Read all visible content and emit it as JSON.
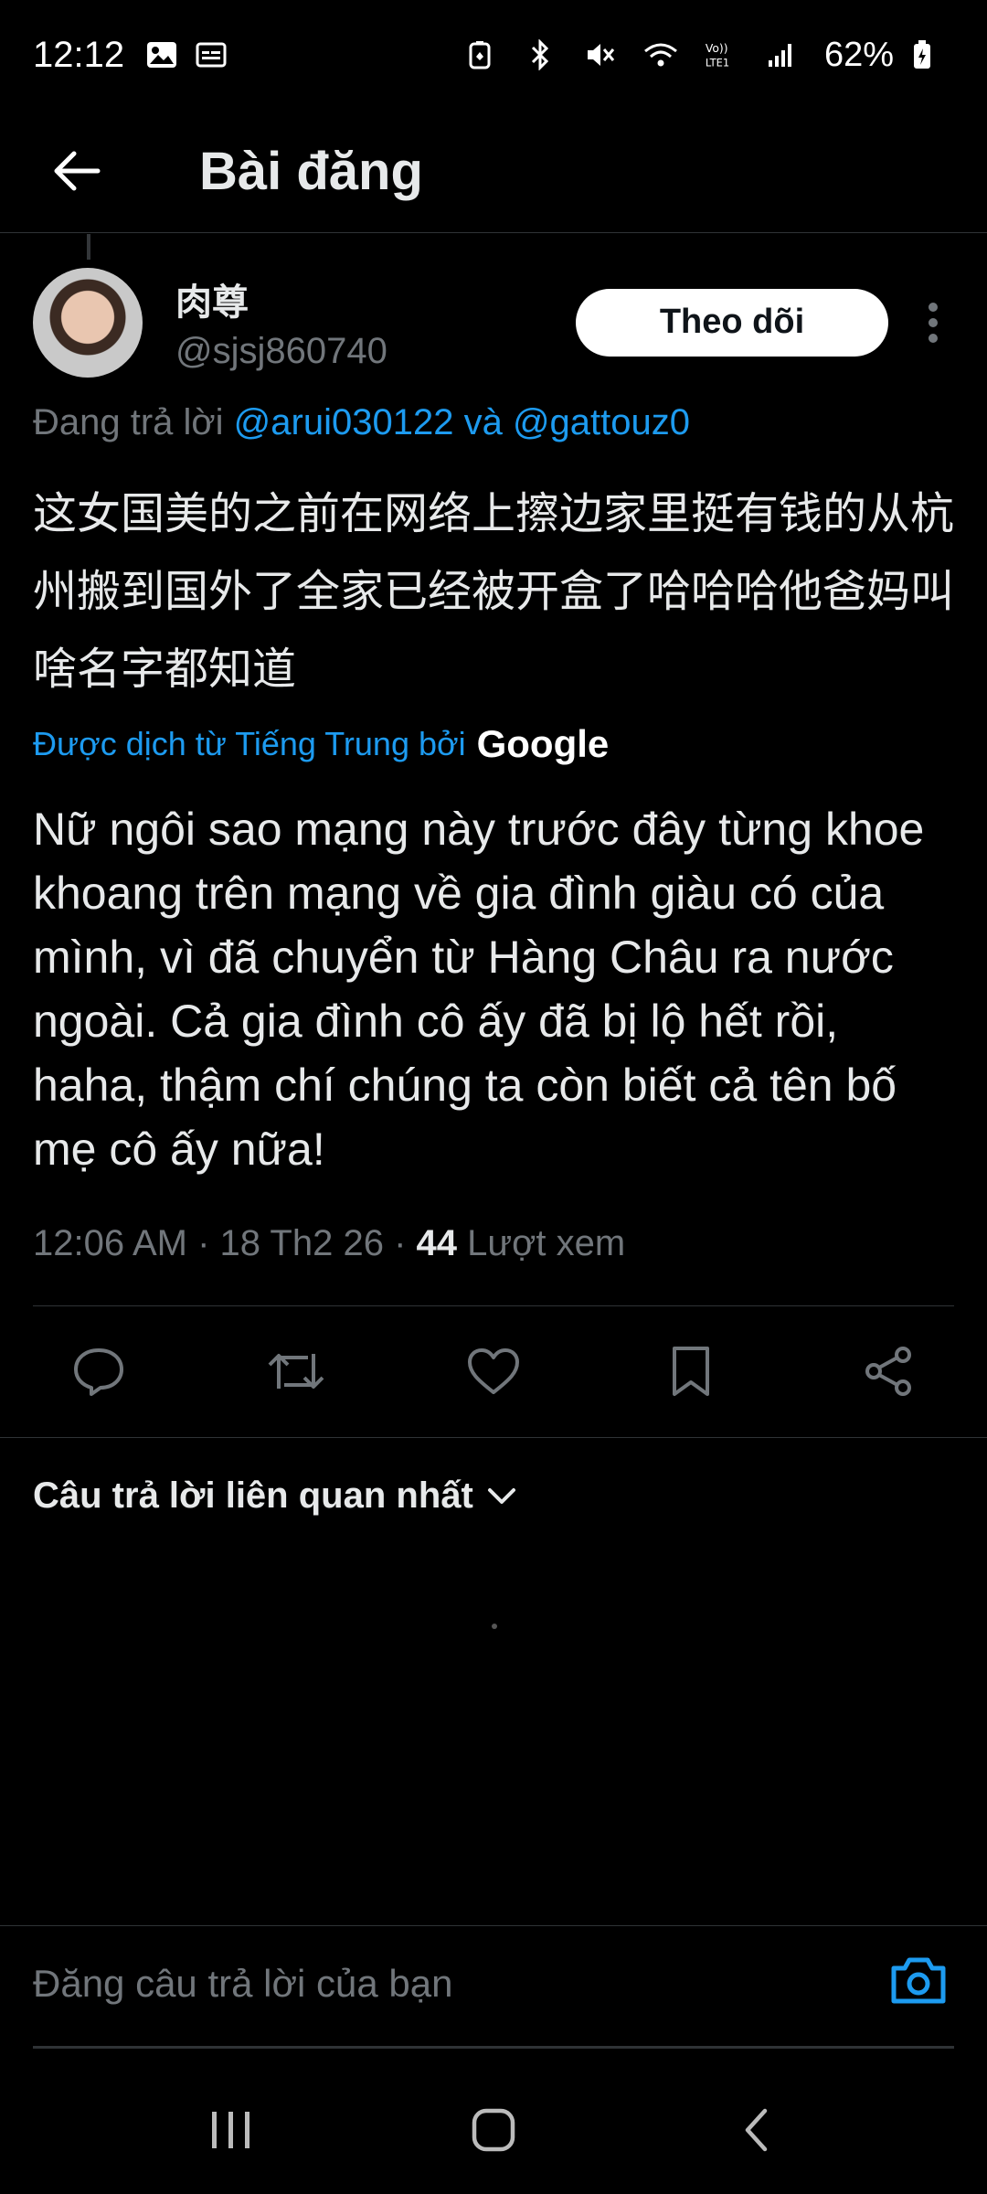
{
  "status_bar": {
    "time": "12:12",
    "battery": "62%",
    "icons": [
      "gallery-icon",
      "subtitle-icon",
      "battery-saver-icon",
      "bluetooth-icon",
      "mute-icon",
      "wifi-icon",
      "volte-icon",
      "signal-icon",
      "battery-icon"
    ]
  },
  "header": {
    "title": "Bài đăng"
  },
  "post": {
    "display_name": "肉尊",
    "handle": "@sjsj860740",
    "follow_label": "Theo dõi",
    "replying_prefix": "Đang trả lời",
    "replying_to_1": "@arui030122",
    "replying_conj": "và",
    "replying_to_2": "@gattouz0",
    "original_text": "这女国美的之前在网络上擦边家里挺有钱的从杭州搬到国外了全家已经被开盒了哈哈哈他爸妈叫啥名字都知道",
    "translated_by": "Được dịch từ Tiếng Trung bởi",
    "translator_brand": "Google",
    "translation": "Nữ ngôi sao mạng này trước đây từng khoe khoang trên mạng về gia đình giàu có của mình, vì đã chuyển từ Hàng Châu ra nước ngoài. Cả gia đình cô ấy đã bị lộ hết rồi, haha, thậm chí chúng ta còn biết cả tên bố mẹ cô ấy nữa!",
    "timestamp": "12:06 AM · 18 Th2 26 ·",
    "views_count": "44",
    "views_label": "Lượt xem"
  },
  "actions": [
    "reply-icon",
    "repost-icon",
    "like-icon",
    "bookmark-icon",
    "share-icon"
  ],
  "replies": {
    "sort_label": "Câu trả lời liên quan nhất"
  },
  "composer": {
    "placeholder": "Đăng câu trả lời của bạn"
  },
  "colors": {
    "background": "#000000",
    "accent": "#1d9bf0",
    "text": "#e7e9ea",
    "muted": "#71767b",
    "border": "#2f3336"
  }
}
